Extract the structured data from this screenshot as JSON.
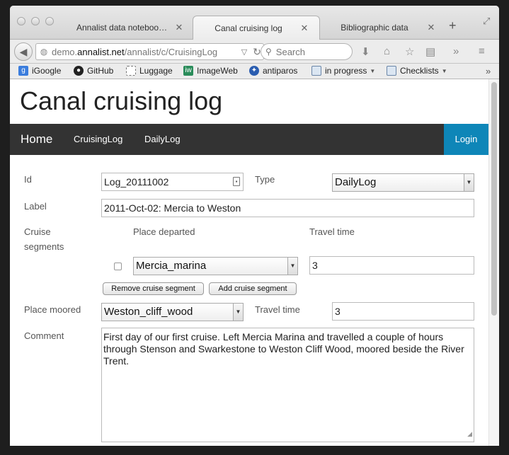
{
  "browser": {
    "tabs": [
      {
        "label": "Annalist data notebook ..."
      },
      {
        "label": "Canal cruising log"
      },
      {
        "label": "Bibliographic data"
      }
    ],
    "url_prefix": "demo.",
    "url_domain": "annalist.net",
    "url_path": "/annalist/c/CruisingLog",
    "search_placeholder": "Search",
    "bookmarks": [
      {
        "label": "iGoogle"
      },
      {
        "label": "GitHub"
      },
      {
        "label": "Luggage"
      },
      {
        "label": "ImageWeb"
      },
      {
        "label": "antiparos"
      },
      {
        "label": "in progress"
      },
      {
        "label": "Checklists"
      }
    ]
  },
  "page": {
    "title": "Canal cruising log",
    "menu": {
      "home": "Home",
      "items": [
        "CruisingLog",
        "DailyLog"
      ],
      "login": "Login"
    },
    "form": {
      "id_label": "Id",
      "id_value": "Log_20111002",
      "type_label": "Type",
      "type_value": "DailyLog",
      "label_label": "Label",
      "label_value": "2011-Oct-02: Mercia to Weston",
      "segments_label_1": "Cruise",
      "segments_label_2": "segments",
      "col_place_departed": "Place departed",
      "col_travel_time": "Travel time",
      "segment": {
        "place": "Mercia_marina",
        "travel_time": "3"
      },
      "remove_segment": "Remove cruise segment",
      "add_segment": "Add cruise segment",
      "moored_label": "Place moored",
      "moored_value": "Weston_cliff_wood",
      "travel_time_label": "Travel time",
      "travel_time_value": "3",
      "comment_label": "Comment",
      "comment_value": "First day of our first cruise.  Left Mercia Marina and travelled a couple of hours through Stenson and Swarkestone to Weston Cliff Wood, moored beside the River Trent."
    }
  }
}
